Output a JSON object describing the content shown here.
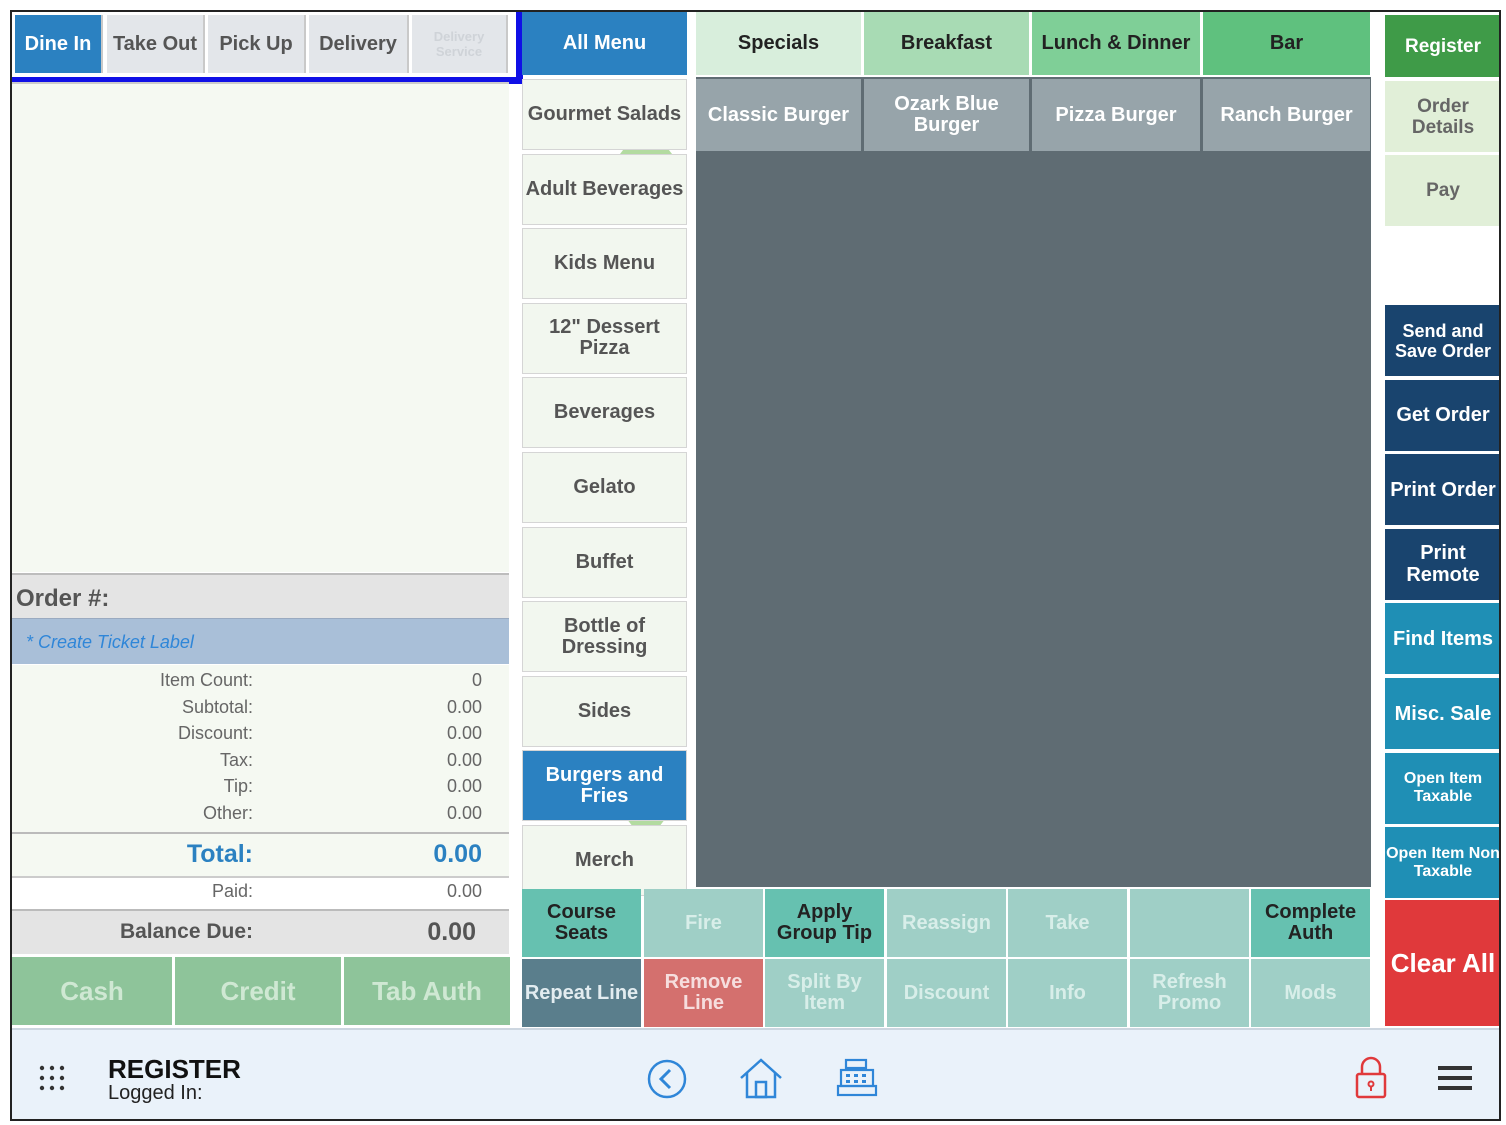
{
  "order_types": [
    "Dine In",
    "Take Out",
    "Pick Up",
    "Delivery",
    "Delivery Service"
  ],
  "order": {
    "number_label": "Order #:",
    "ticket_label_placeholder": "* Create Ticket Label",
    "summary": [
      {
        "label": "Item Count:",
        "value": "0"
      },
      {
        "label": "Subtotal:",
        "value": "0.00"
      },
      {
        "label": "Discount:",
        "value": "0.00"
      },
      {
        "label": "Tax:",
        "value": "0.00"
      },
      {
        "label": "Tip:",
        "value": "0.00"
      },
      {
        "label": "Other:",
        "value": "0.00"
      }
    ],
    "total_label": "Total:",
    "total_value": "0.00",
    "paid_label": "Paid:",
    "paid_value": "0.00",
    "balance_label": "Balance Due:",
    "balance_value": "0.00"
  },
  "payment": [
    "Cash",
    "Credit",
    "Tab Auth"
  ],
  "all_menu": "All Menu",
  "categories": [
    "Gourmet Salads",
    "Adult Beverages",
    "Kids Menu",
    "12\" Dessert Pizza",
    "Beverages",
    "Gelato",
    "Buffet",
    "Bottle of Dressing",
    "Sides",
    "Burgers and Fries",
    "Merch"
  ],
  "groups": [
    "Specials",
    "Breakfast",
    "Lunch & Dinner",
    "Bar"
  ],
  "items": [
    "Classic Burger",
    "Ozark Blue Burger",
    "Pizza Burger",
    "Ranch Burger"
  ],
  "right_top": [
    "Register",
    "Order Details",
    "Pay"
  ],
  "right_side": [
    "Send and Save Order",
    "Get Order",
    "Print Order",
    "Print Remote",
    "Find Items",
    "Misc. Sale",
    "Open Item Taxable",
    "Open Item Non Taxable"
  ],
  "clear_all": "Clear All",
  "actions_row1": [
    "Course Seats",
    "Fire",
    "Apply Group Tip",
    "Reassign",
    "Take",
    "",
    "Complete Auth"
  ],
  "actions_row2": [
    "Repeat Line",
    "Remove Line",
    "Split By Item",
    "Discount",
    "Info",
    "Refresh Promo",
    "Mods"
  ],
  "footer": {
    "title": "REGISTER",
    "subtitle": "Logged In:",
    "icons": [
      "grid-icon",
      "back-icon",
      "home-icon",
      "cash-register-icon",
      "lock-icon",
      "hamburger-menu-icon"
    ]
  },
  "colors": {
    "primary_blue": "#2b81c1",
    "navy": "#19446e",
    "teal": "#1f8fb5",
    "clear_red": "#e0393b",
    "register_green": "#3f9b48",
    "annotation_blue": "#1010e6"
  }
}
